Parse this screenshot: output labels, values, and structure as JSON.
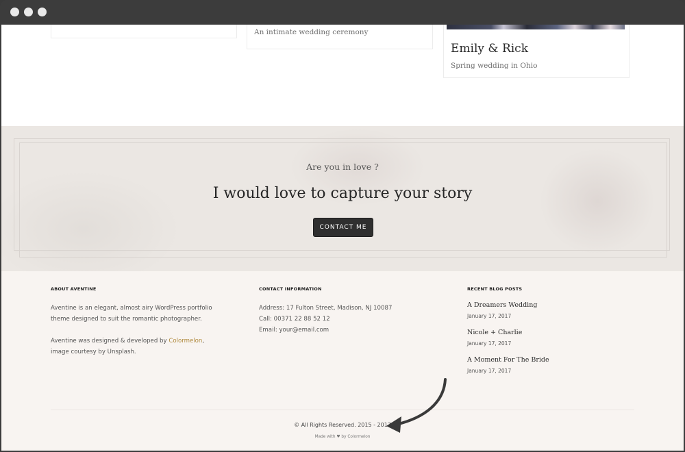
{
  "cards": [
    {
      "subtitle": "An intimate wedding ceremony"
    },
    {
      "title": "Emily & Rick",
      "subtitle": "Spring wedding in Ohio"
    }
  ],
  "cta": {
    "eyebrow": "Are you in love ?",
    "heading": "I would love to capture your story",
    "button": "CONTACT ME"
  },
  "footer": {
    "about": {
      "title": "ABOUT AVENTINE",
      "paragraph1": "Aventine is an elegant, almost airy WordPress portfolio theme designed to suit the romantic photographer.",
      "paragraph2_before": "Aventine was designed & developed by ",
      "paragraph2_link": "Colormelon",
      "paragraph2_after": ", image courtesy by Unsplash."
    },
    "contact": {
      "title": "CONTACT INFORMATION",
      "address": "Address: 17 Fulton Street, Madison, NJ 10087",
      "call": "Call: 00371 22 88 52 12",
      "email": "Email: your@email.com"
    },
    "posts": {
      "title": "RECENT BLOG POSTS",
      "items": [
        {
          "title": "A Dreamers Wedding",
          "date": "January 17, 2017"
        },
        {
          "title": "Nicole + Charlie",
          "date": "January 17, 2017"
        },
        {
          "title": "A Moment For The Bride",
          "date": "January 17, 2017"
        }
      ]
    },
    "copyright": "© All Rights Reserved. 2015 - 2017",
    "made_with_before": "Made with",
    "made_with_after": "by Colormelon"
  },
  "colors": {
    "accent_link": "#b08a3e",
    "button_bg": "#2f2f2f",
    "footer_bg": "#f8f4f1"
  }
}
